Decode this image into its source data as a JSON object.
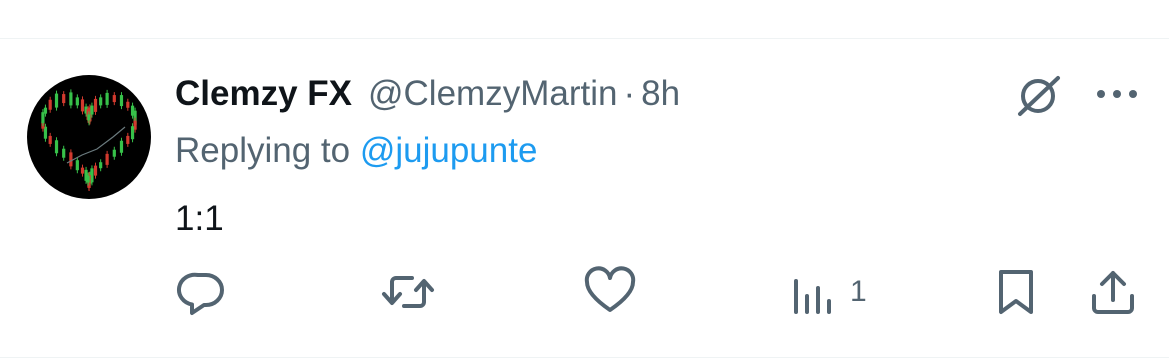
{
  "tweet": {
    "author_name": "Clemzy FX",
    "author_handle": "@ClemzyMartin",
    "separator": "·",
    "time": "8h",
    "replying_prefix": "Replying to ",
    "replying_to": "@jujupunte",
    "text": "1:1"
  },
  "actions": {
    "reply_icon": "reply-icon",
    "retweet_icon": "retweet-icon",
    "like_icon": "like-icon",
    "views_icon": "views-icon",
    "views_count": "1",
    "bookmark_icon": "bookmark-icon",
    "share_icon": "share-icon"
  },
  "icons": {
    "grok": "grok-icon",
    "more": "more-icon"
  },
  "colors": {
    "text_primary": "#0f1419",
    "text_secondary": "#536471",
    "link": "#1d9bf0",
    "divider": "#eff3f4"
  }
}
